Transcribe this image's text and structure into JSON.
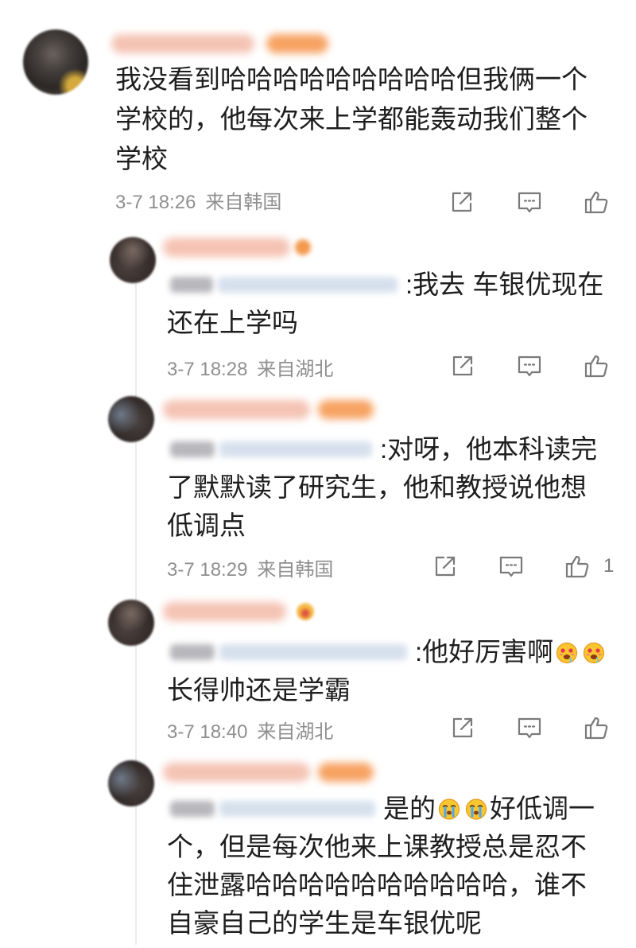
{
  "colors": {
    "text": "#1e1e1e",
    "meta": "#8f8f8f",
    "icon": "#7a7a7a",
    "background": "#ffffff",
    "thread": "#ececec"
  },
  "icons": {
    "share": "share-icon",
    "comment": "comment-icon",
    "like": "like-icon"
  },
  "main_comment": {
    "lines": [
      "我没看到哈哈哈哈哈哈哈哈哈但我俩一个",
      "学校的，他每次来上学都能轰动我们整个",
      "学校"
    ],
    "time": "3-7 18:26",
    "source": "来自韩国"
  },
  "replies": [
    {
      "first_line": ":我去 车银优现在",
      "lines": [
        "还在上学吗"
      ],
      "time": "3-7 18:28",
      "source": "来自湖北"
    },
    {
      "first_line": ":对呀，他本科读完",
      "lines": [
        "了默默读了研究生，他和教授说他想",
        "低调点"
      ],
      "time": "3-7 18:29",
      "source": "来自韩国",
      "like_count": "1"
    },
    {
      "first_line": ":他好厉害啊",
      "first_line_emojis": [
        "drool-emoji-icon",
        "drool-emoji-icon"
      ],
      "lines": [
        "长得帅还是学霸"
      ],
      "time": "3-7 18:40",
      "source": "来自湖北"
    },
    {
      "first_line": "是的",
      "first_line_emojis": [
        "cry-emoji-icon",
        "cry-emoji-icon"
      ],
      "first_line_after": "好低调一",
      "lines": [
        "个，但是每次他来上课教授总是忍不",
        "住泄露哈哈哈哈哈哈哈哈哈哈，谁不",
        "自豪自己的学生是车银优呢"
      ]
    }
  ]
}
